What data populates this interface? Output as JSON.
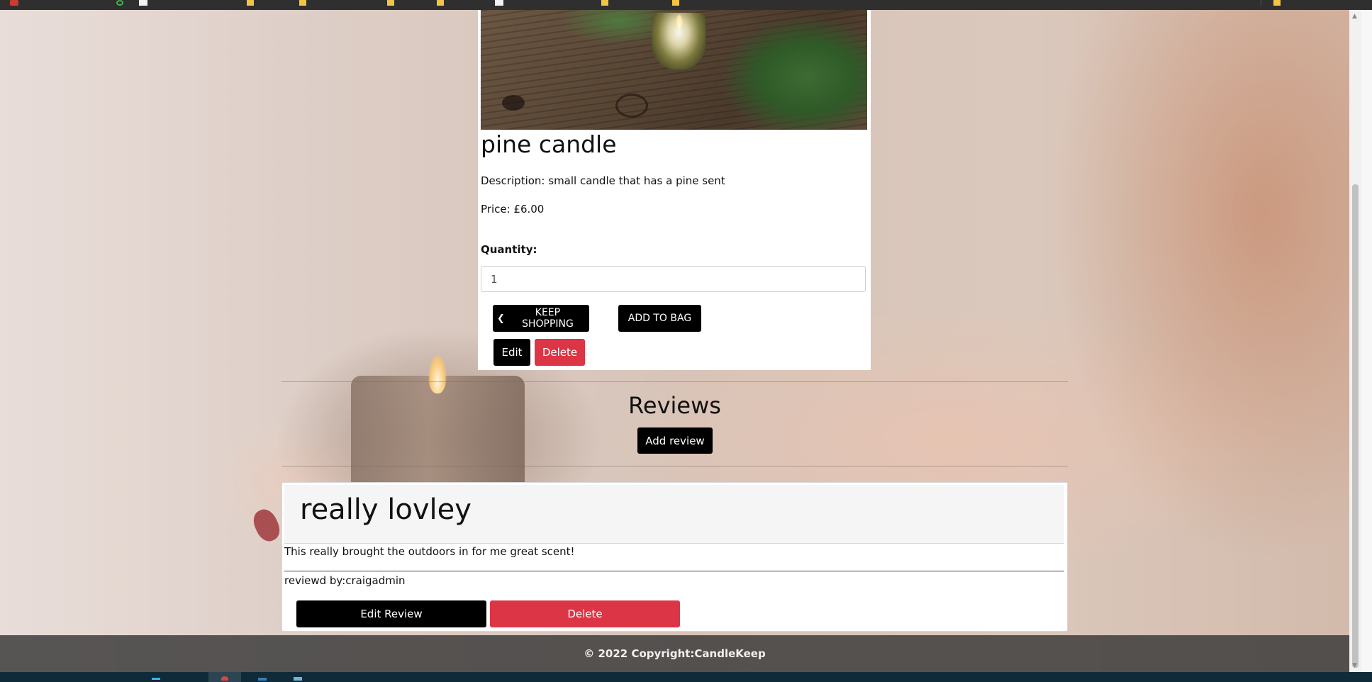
{
  "product": {
    "name": "pine candle",
    "description": "Description: small candle that has a pine sent",
    "price": "Price: £6.00",
    "quantity_label": "Quantity:",
    "quantity_value": "1",
    "keep_shopping_label": "KEEP SHOPPING",
    "add_to_bag_label": "ADD TO BAG",
    "edit_label": "Edit",
    "delete_label": "Delete"
  },
  "reviews": {
    "heading": "Reviews",
    "add_review_label": "Add review",
    "items": [
      {
        "title": "really lovley",
        "body": "This really brought the outdoors in for me great scent!",
        "reviewed_by": "reviewd by:craigadmin",
        "edit_label": "Edit Review",
        "delete_label": "Delete"
      }
    ]
  },
  "footer": {
    "copyright": "© 2022 Copyright:CandleKeep"
  },
  "icons": {
    "keep_shopping": "chevron-left-icon",
    "scroll_up": "scroll-up-arrow-icon",
    "scroll_down": "scroll-down-arrow-icon"
  },
  "colors": {
    "primary_button": "#000000",
    "danger_button": "#dc3545",
    "footer_bg": "#373737"
  }
}
